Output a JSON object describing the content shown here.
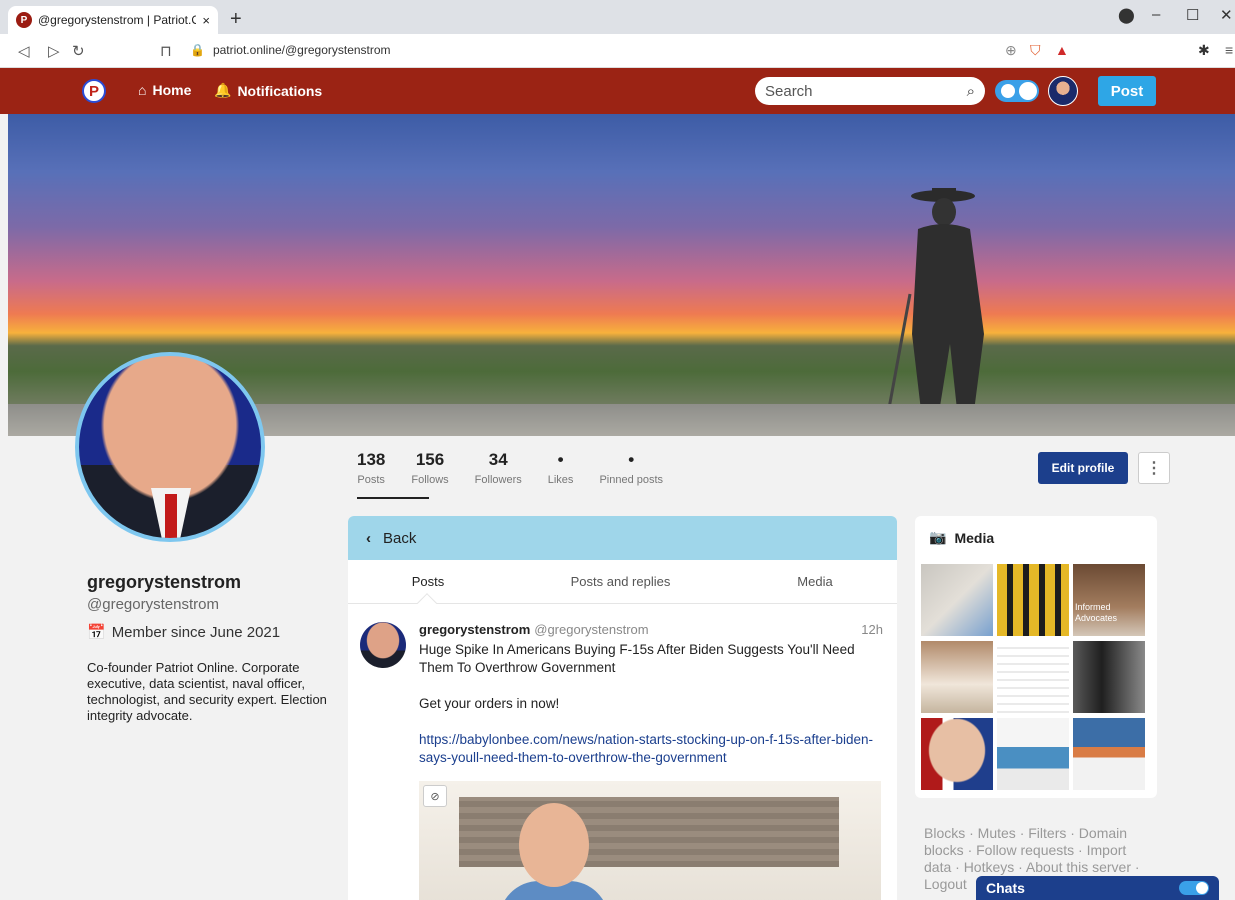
{
  "browser": {
    "tab_title": "@gregorystenstrom | Patriot.Onli",
    "tab_close": "×",
    "new_tab": "+",
    "url": "patriot.online/@gregorystenstrom"
  },
  "nav": {
    "logo_letter": "P",
    "home_label": "Home",
    "notifications_label": "Notifications",
    "search_placeholder": "Search",
    "post_label": "Post"
  },
  "profile": {
    "display_name": "gregorystenstrom",
    "handle": "@gregorystenstrom",
    "member_since": "Member since June 2021",
    "bio": "Co-founder Patriot Online. Corporate executive, data scientist, naval officer, technologist, and security expert. Election integrity advocate.",
    "stats": [
      {
        "num": "138",
        "label": "Posts"
      },
      {
        "num": "156",
        "label": "Follows"
      },
      {
        "num": "34",
        "label": "Followers"
      },
      {
        "num": "•",
        "label": "Likes"
      },
      {
        "num": "•",
        "label": "Pinned posts"
      }
    ],
    "edit_label": "Edit profile",
    "more_label": "⋮"
  },
  "feed": {
    "back_label": "Back",
    "tabs": [
      "Posts",
      "Posts and replies",
      "Media"
    ],
    "status": {
      "name": "gregorystenstrom",
      "acct": "@gregorystenstrom",
      "time": "12h",
      "headline": "Huge Spike In Americans Buying F-15s After Biden Suggests You'll Need Them To Overthrow Government",
      "line2": "Get your orders in now!",
      "link": "https://babylonbee.com/news/nation-starts-stocking-up-on-f-15s-after-biden-says-youll-need-them-to-overthrow-the-government"
    }
  },
  "media": {
    "title": "Media",
    "thumb3_text": "Informed Advocates"
  },
  "footer_links": "Blocks · Mutes · Filters · Domain blocks · Follow requests · Import data · Hotkeys · About this server · Logout",
  "chats_label": "Chats",
  "colors": {
    "nav_red": "#9b2314",
    "accent_blue": "#2ea6e6",
    "edit_blue": "#1c3f8c",
    "back_bar": "#9fd6ea"
  }
}
